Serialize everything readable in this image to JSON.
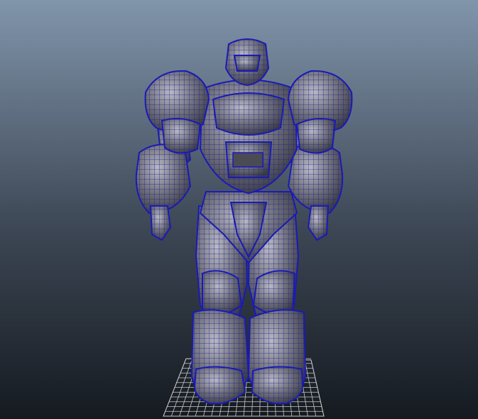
{
  "viewport": {
    "background_top_color": "#8195ab",
    "background_mid_color": "#3c4654",
    "background_bottom_color": "#151a20"
  },
  "model": {
    "surface_color": "#6e6f7a",
    "surface_highlight_color": "#b9bac6",
    "surface_shadow_color": "#3a3b45",
    "wireframe_color": "#1a1ab8",
    "wireframe_fine_color": "#20208f"
  },
  "grid": {
    "line_color": "#c9c9c9",
    "visible": true
  }
}
